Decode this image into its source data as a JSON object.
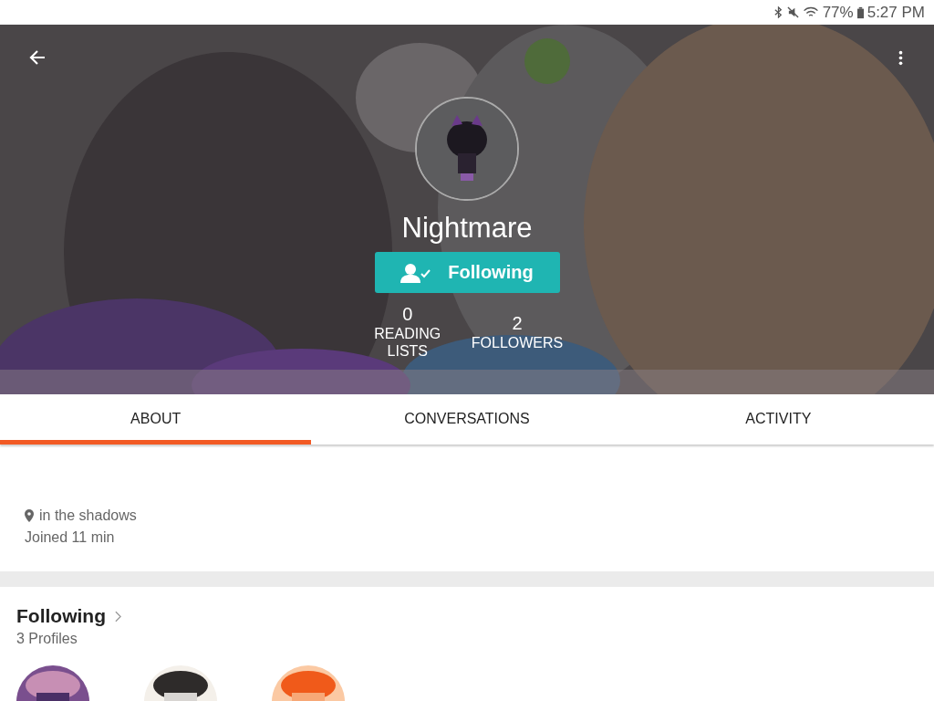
{
  "status_bar": {
    "battery": "77%",
    "time": "5:27 PM"
  },
  "profile": {
    "name": "Nightmare",
    "follow_button": "Following",
    "stats": [
      {
        "value": "0",
        "label": "READING LISTS"
      },
      {
        "value": "2",
        "label": "FOLLOWERS"
      }
    ]
  },
  "tabs": [
    {
      "label": "ABOUT",
      "selected": true
    },
    {
      "label": "CONVERSATIONS",
      "selected": false
    },
    {
      "label": "ACTIVITY",
      "selected": false
    }
  ],
  "about": {
    "location": "in the shadows",
    "joined": "Joined 11 min"
  },
  "following": {
    "title": "Following",
    "count": "3 Profiles"
  }
}
